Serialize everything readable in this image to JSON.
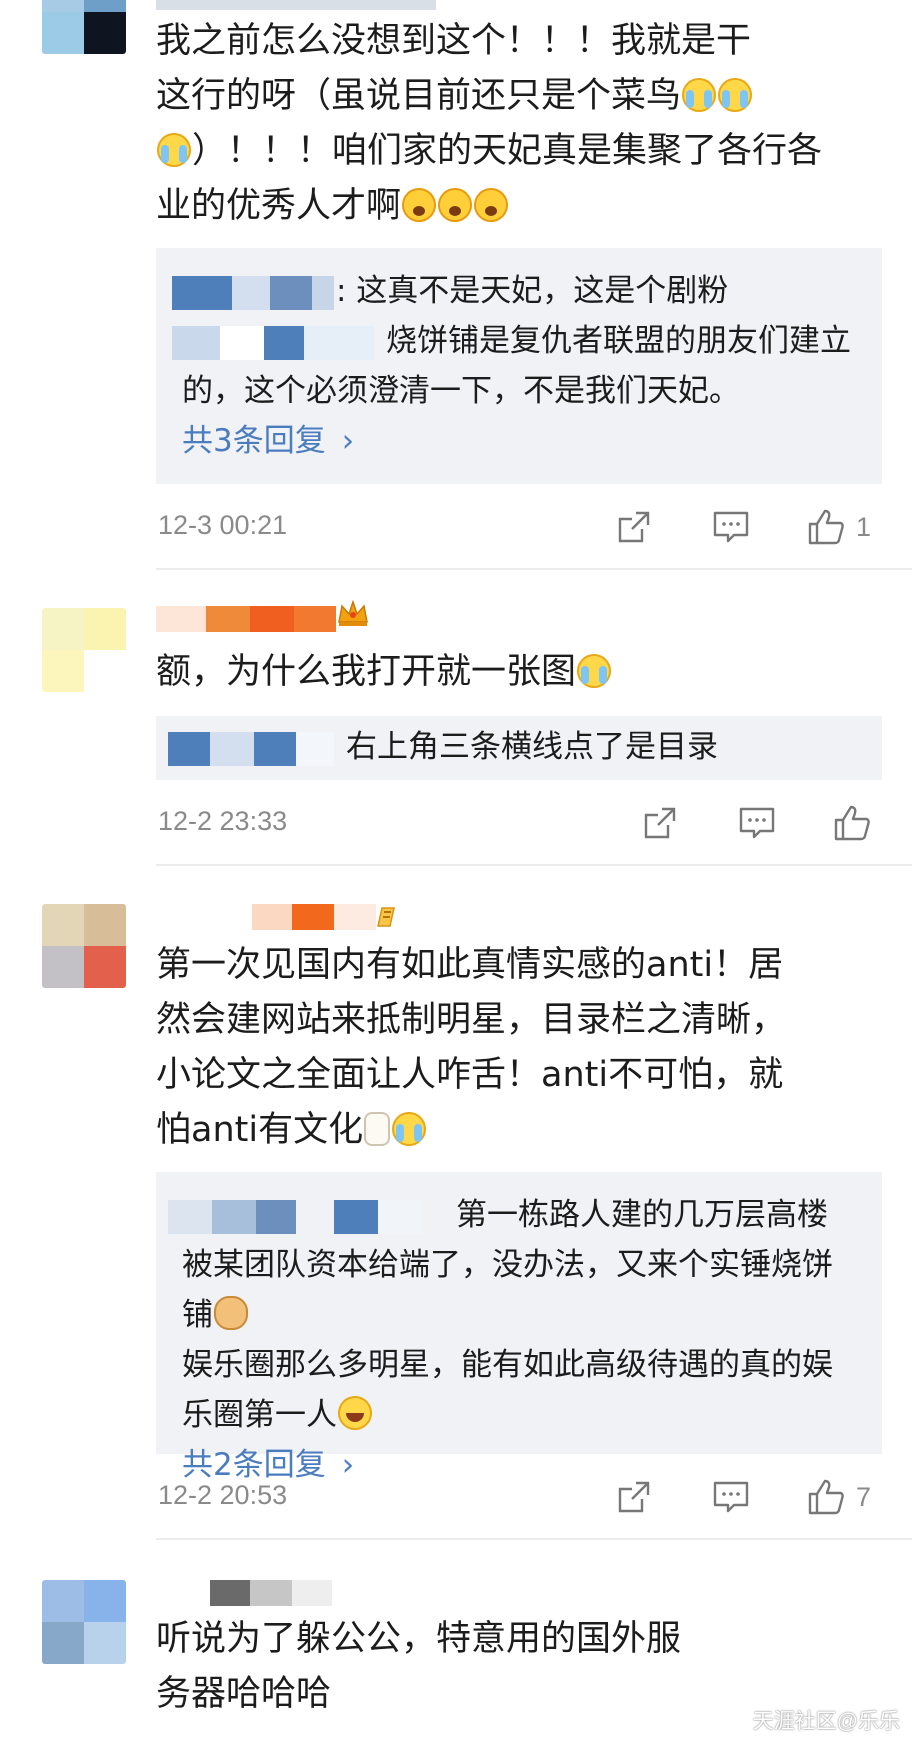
{
  "comments": [
    {
      "text_lines": [
        "我之前怎么没想到这个！！！我就是干",
        "这行的呀（虽说目前还只是个菜鸟",
        "）！！！咱们家的天妃真是集聚了各行各",
        "业的优秀人才啊"
      ],
      "replies": [
        {
          "text": ": 这真不是天妃，这是个剧粉"
        },
        {
          "text": "烧饼铺是复仇者联盟的朋友们建立的，这个必须澄清一下，不是我们天妃。"
        }
      ],
      "more_replies": "共3条回复",
      "timestamp": "12-3 00:21",
      "like_count": "1"
    },
    {
      "text_lines": [
        "额，为什么我打开就一张图"
      ],
      "replies": [
        {
          "text": "右上角三条横线点了是目录"
        }
      ],
      "timestamp": "12-2 23:33",
      "like_count": ""
    },
    {
      "text_lines": [
        "第一次见国内有如此真情实感的anti！居",
        "然会建网站来抵制明星，目录栏之清晰，",
        "小论文之全面让人咋舌！anti不可怕，就",
        "怕anti有文化"
      ],
      "replies": [
        {
          "text": "第一栋路人建的几万层高楼被某团队资本给端了，没办法，又来个实锤烧饼铺"
        },
        {
          "text": "娱乐圈那么多明星，能有如此高级待遇的真的娱乐圈第一人"
        }
      ],
      "more_replies": "共2条回复",
      "timestamp": "12-2 20:53",
      "like_count": "7"
    },
    {
      "text_lines": [
        "听说为了躲公公，特意用的国外服",
        "务器哈哈哈"
      ]
    }
  ],
  "icons": {
    "share": "share-icon",
    "comment": "comment-icon",
    "like": "like-icon",
    "more": "chevron-right-icon"
  },
  "colors": {
    "link": "#4a7cc0",
    "meta": "#8a8a8a",
    "reply_bg": "#f1f2f5"
  },
  "watermark": "天涯社区@乐乐"
}
